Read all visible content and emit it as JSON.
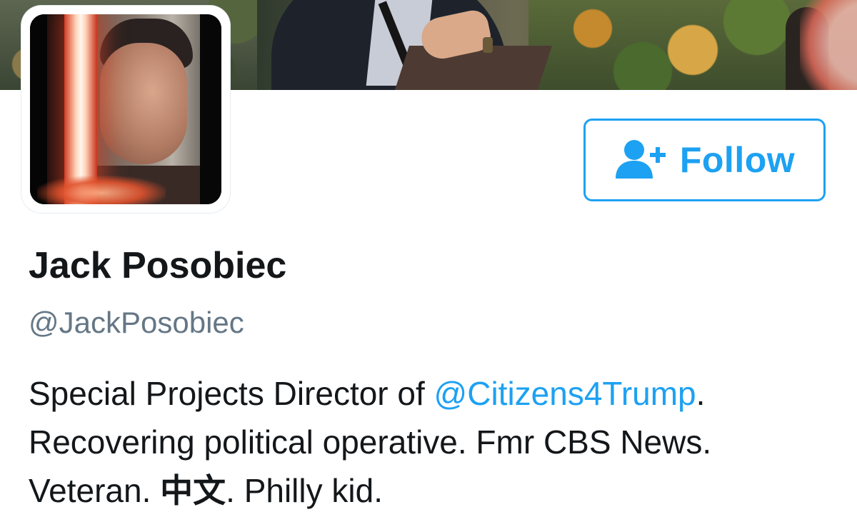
{
  "profile": {
    "display_name": "Jack Posobiec",
    "handle": "@JackPosobiec",
    "bio": {
      "line1_prefix": "Special Projects Director of ",
      "line1_mention": "@Citizens4Trump",
      "line1_suffix": ".",
      "line2": "Recovering political operative. Fmr CBS News.",
      "line3_prefix": "Veteran. ",
      "line3_cjk": "中文",
      "line3_suffix": ". Philly kid."
    }
  },
  "follow_button": {
    "label": "Follow",
    "icon": "add-user-icon"
  },
  "colors": {
    "accent": "#1da1f2",
    "name_text": "#14171a",
    "handle_text": "#657786"
  }
}
